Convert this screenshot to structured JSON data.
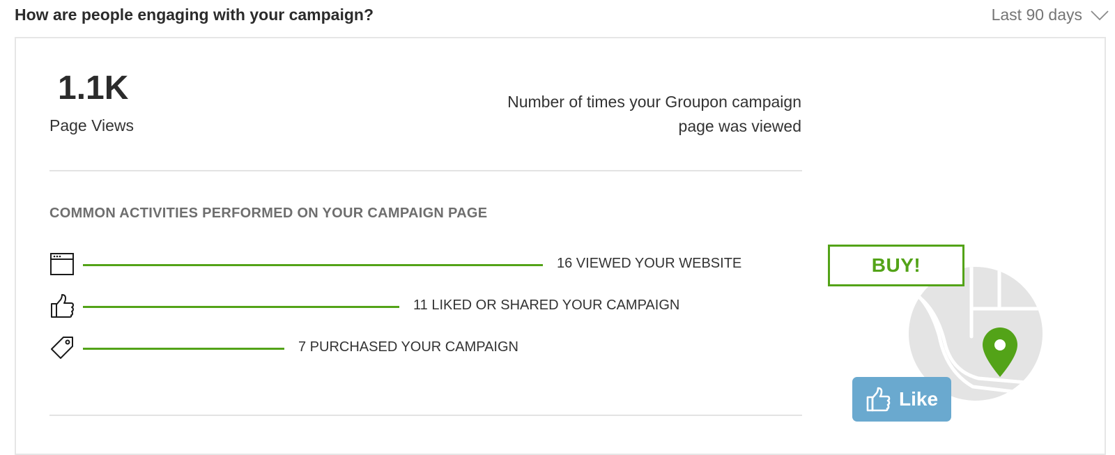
{
  "header": {
    "title": "How are people engaging with your campaign?",
    "range_label": "Last 90 days",
    "range_icon": "chevron-down-icon"
  },
  "metric": {
    "value": "1.1K",
    "label": "Page Views",
    "description": "Number of times your Groupon campaign page was viewed"
  },
  "activities": {
    "section_title": "COMMON ACTIVITIES PERFORMED ON YOUR CAMPAIGN PAGE",
    "bar_color": "#53a318",
    "items": [
      {
        "icon": "browser-window-icon",
        "count": 16,
        "label": "16 VIEWED YOUR WEBSITE"
      },
      {
        "icon": "thumbs-up-icon",
        "count": 11,
        "label": "11 LIKED OR SHARED YOUR CAMPAIGN"
      },
      {
        "icon": "price-tag-icon",
        "count": 7,
        "label": "7 PURCHASED YOUR CAMPAIGN"
      }
    ]
  },
  "illustration": {
    "buy_label": "BUY!",
    "like_label": "Like",
    "map_icon": "map-pin-icon",
    "accent_color": "#53a318",
    "like_color": "#6aa9cf"
  }
}
